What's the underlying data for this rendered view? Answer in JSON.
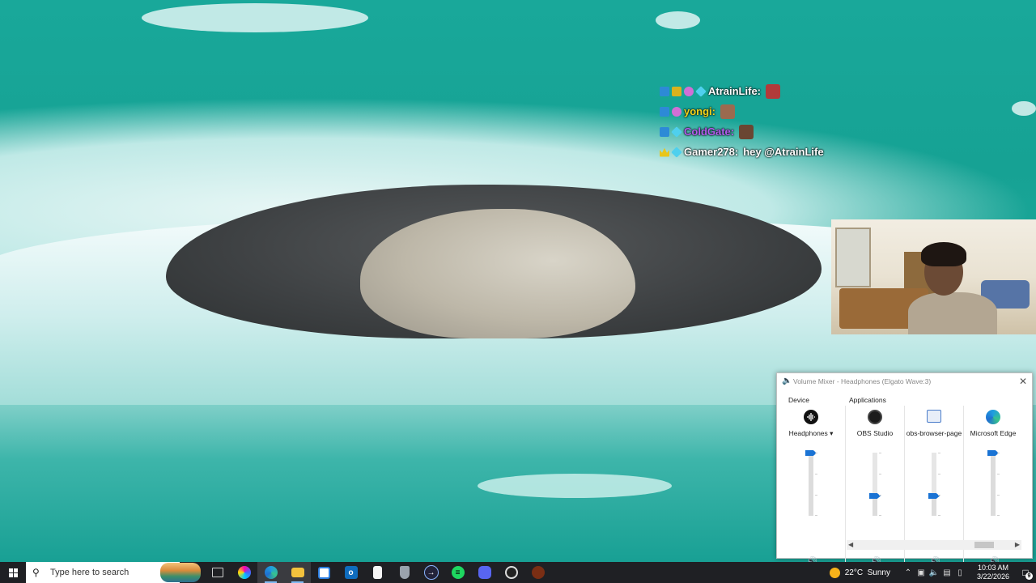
{
  "chat": {
    "messages": [
      {
        "user": "AtrainLife:",
        "color": "#ffffff",
        "message": ""
      },
      {
        "user": "yongi:",
        "color": "#f2d21b",
        "message": ""
      },
      {
        "user": "ColdGate:",
        "color": "#b45cf0",
        "message": ""
      },
      {
        "user": "Gamer278:",
        "color": "#ffffff",
        "message": "hey @AtrainLife"
      }
    ]
  },
  "mixer": {
    "title": "Volume Mixer - Headphones (Elgato Wave:3)",
    "device_section": "Device",
    "applications_section": "Applications",
    "device": {
      "label": "Headphones",
      "icon": "headphones-icon",
      "level": 1.0
    },
    "apps": [
      {
        "label": "OBS Studio",
        "icon": "obs-icon",
        "level": 0.33
      },
      {
        "label": "obs-browser-page",
        "icon": "browser-page-icon",
        "level": 0.33
      },
      {
        "label": "Microsoft Edge",
        "icon": "edge-icon",
        "level": 1.0
      }
    ],
    "accent": "#1a73d4"
  },
  "taskbar": {
    "search_placeholder": "Type here to search",
    "apps": [
      "task-view-icon",
      "copilot-icon",
      "edge-icon",
      "file-explorer-icon",
      "microsoft-store-icon",
      "outlook-icon",
      "notepad-icon",
      "security-icon",
      "streaming-app-icon",
      "spotify-icon",
      "discord-icon",
      "obs-icon",
      "game-icon"
    ],
    "weather": {
      "temp": "22°C",
      "condition": "Sunny"
    },
    "time": "10:03 AM",
    "date": "3/22/2026",
    "notifications": "9"
  }
}
